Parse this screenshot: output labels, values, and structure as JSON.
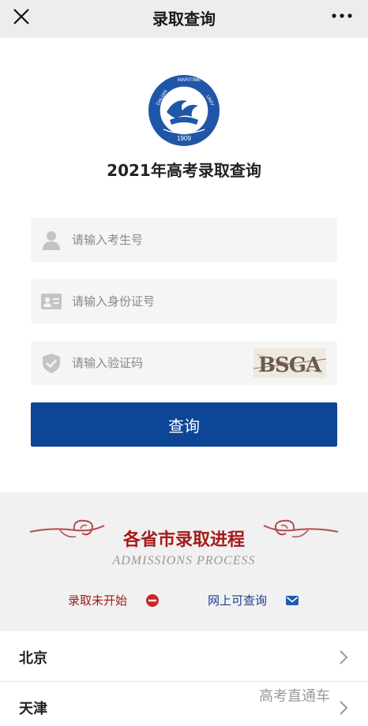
{
  "header": {
    "title": "录取查询",
    "close_icon": "close-icon",
    "more_icon": "more-icon"
  },
  "logo": {
    "icon": "university-logo-icon",
    "year": "1909"
  },
  "page_title": "2021年高考录取查询",
  "form": {
    "exam_number_placeholder": "请输入考生号",
    "id_number_placeholder": "请输入身份证号",
    "captcha_placeholder": "请输入验证码",
    "captcha_text": "BSGA",
    "submit_label": "查询"
  },
  "progress": {
    "title": "各省市录取进程",
    "subtitle": "ADMISSIONS PROCESS",
    "legend_not_started": "录取未开始",
    "legend_available": "网上可查询",
    "colors": {
      "not_started": "#c62828",
      "available": "#1e5bb5"
    }
  },
  "provinces": [
    {
      "name": "北京"
    },
    {
      "name": "天津"
    }
  ],
  "watermark": "高考直通车",
  "colors": {
    "primary": "#0d4597",
    "topbar": "#ededed",
    "progress_title": "#a61a1a"
  }
}
